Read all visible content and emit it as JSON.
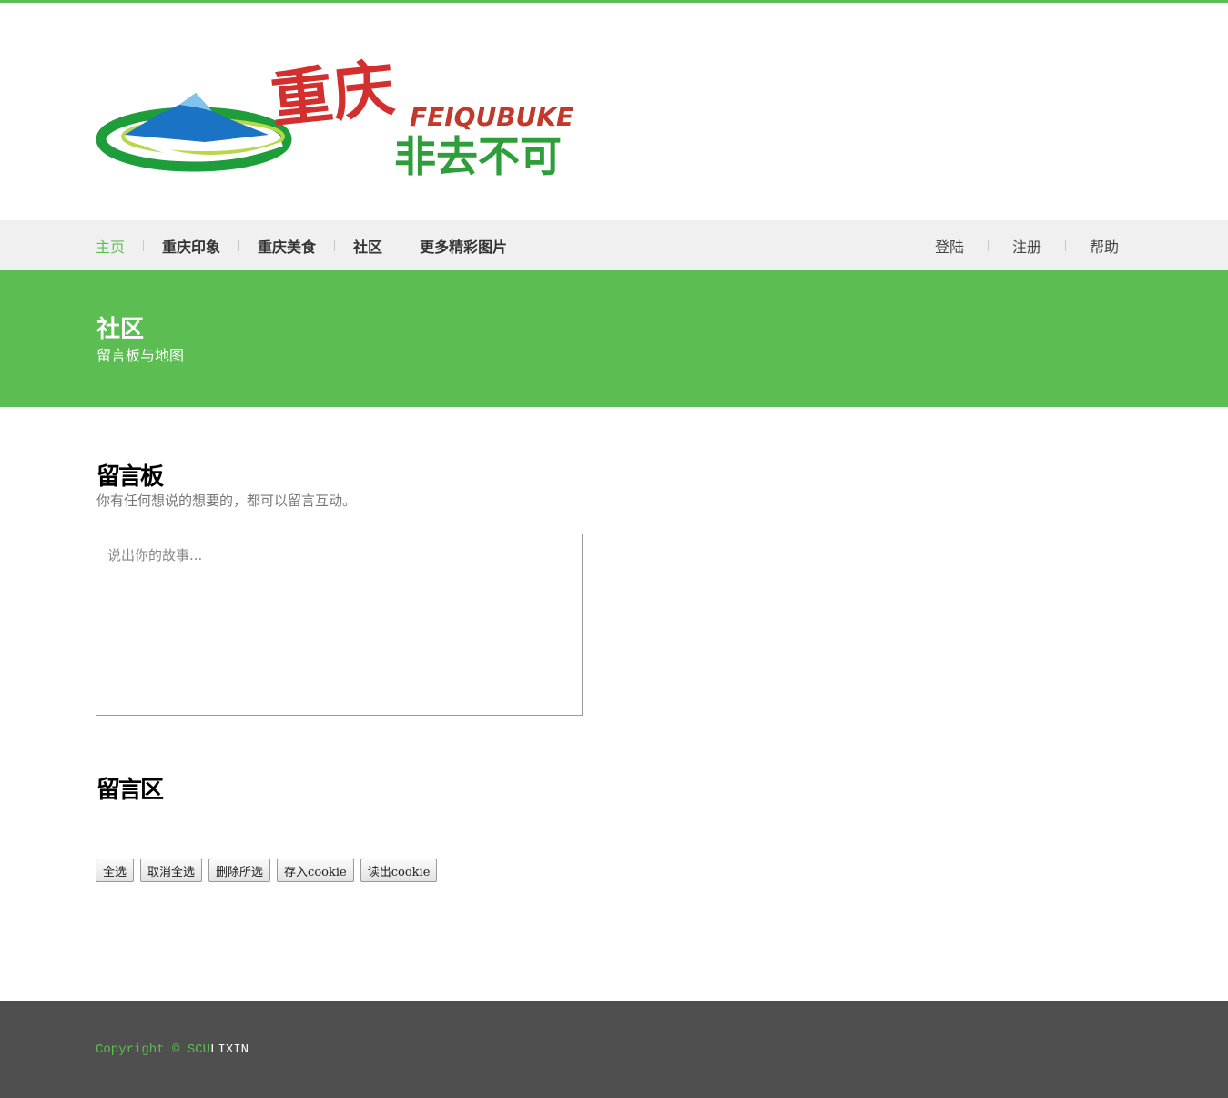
{
  "logo": {
    "brand_cn_big": "重庆",
    "brand_cn_small": "非去不可",
    "brand_en": "FEIQUBUKE"
  },
  "nav": {
    "left": [
      {
        "label": "主页",
        "active": true
      },
      {
        "label": "重庆印象",
        "active": false
      },
      {
        "label": "重庆美食",
        "active": false
      },
      {
        "label": "社区",
        "active": false
      },
      {
        "label": "更多精彩图片",
        "active": false
      }
    ],
    "right": [
      {
        "label": "登陆"
      },
      {
        "label": "注册"
      },
      {
        "label": "帮助"
      }
    ]
  },
  "banner": {
    "title": "社区",
    "subtitle": "留言板与地图"
  },
  "board": {
    "title": "留言板",
    "description": "你有任何想说的想要的，都可以留言互动。",
    "textarea_placeholder": "说出你的故事..."
  },
  "message_area": {
    "title": "留言区"
  },
  "buttons": {
    "select_all": "全选",
    "deselect_all": "取消全选",
    "delete_selected": "删除所选",
    "save_cookie": "存入cookie",
    "read_cookie": "读出cookie"
  },
  "footer": {
    "copyright_prefix": "Copyright © SCU",
    "copyright_owner": "LIXIN"
  },
  "colors": {
    "accent": "#5cbd52",
    "footer_bg": "#4f4f4f",
    "nav_bg": "#f0f0f0"
  }
}
